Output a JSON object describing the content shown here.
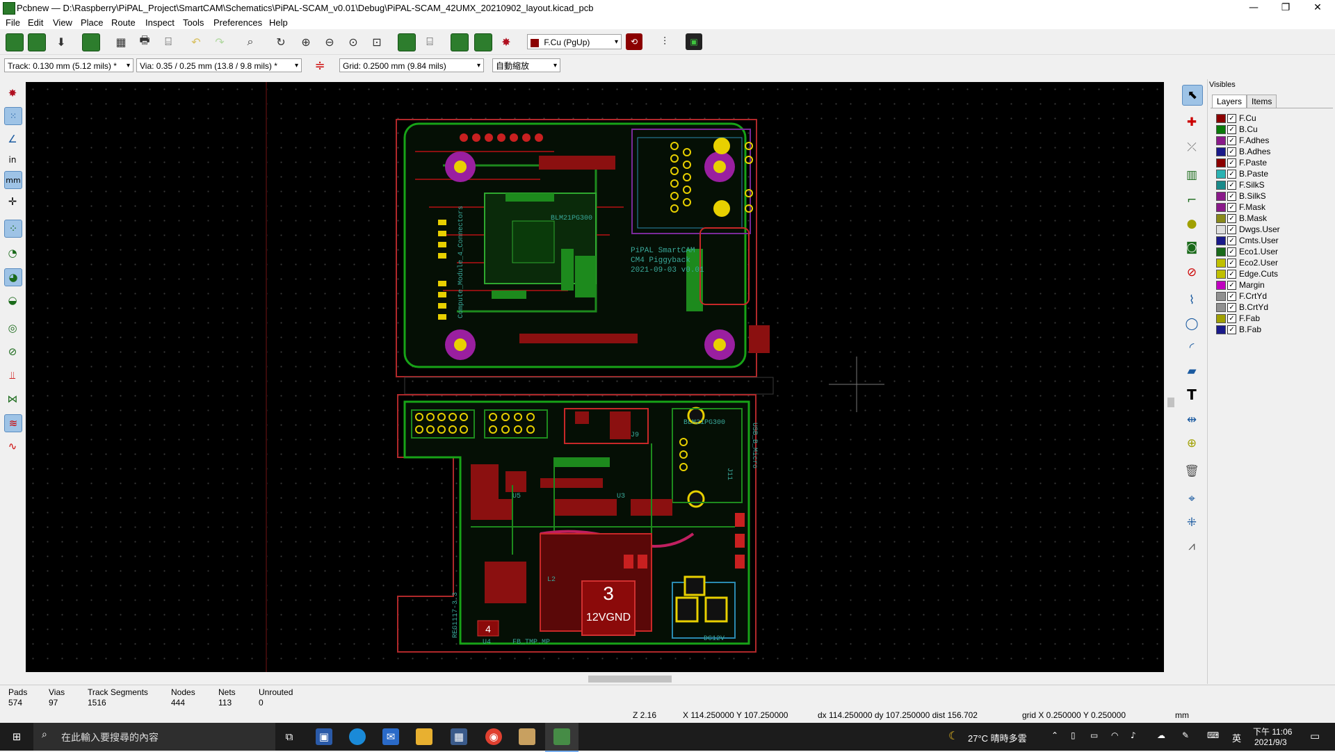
{
  "window": {
    "title": "Pcbnew — D:\\Raspberry\\PiPAL_Project\\SmartCAM\\Schematics\\PiPAL-SCAM_v0.01\\Debug\\PiPAL-SCAM_42UMX_20210902_layout.kicad_pcb",
    "minimize": "—",
    "restore": "❐",
    "close": "✕"
  },
  "menu": [
    "File",
    "Edit",
    "View",
    "Place",
    "Route",
    "Inspect",
    "Tools",
    "Preferences",
    "Help"
  ],
  "toolbar": {
    "layer_select": "F.Cu (PgUp)",
    "track": "Track: 0.130 mm (5.12 mils) *",
    "via": "Via: 0.35 / 0.25 mm (13.8 / 9.8 mils) *",
    "grid": "Grid: 0.2500 mm (9.84 mils)",
    "zoom": "自動縮放"
  },
  "pcb": {
    "silk": {
      "board_name": "PiPAL SmartCAM",
      "board_sub": "CM4 Piggyback",
      "board_date": "2021-09-03 v0.01",
      "compute_label": "Compute_Module_4_Connectors",
      "blm_top": "BLM21PG300",
      "blm_bottom": "BLM21PG300",
      "usb_label": "USB_B_Micro",
      "reg_label": "REG1117-3.3",
      "dc_label": "DC12V",
      "j9": "J9",
      "j11": "J11",
      "u4": "U4",
      "u5": "U5",
      "u3": "U3",
      "l2": "L2",
      "fb_label": "FB_TMP.MP",
      "pad3": "3",
      "net_12v": "12VGND",
      "pad4": "4"
    }
  },
  "layers_panel": {
    "header": "Visibles",
    "tabs": [
      "Layers",
      "Items"
    ],
    "layers": [
      {
        "name": "F.Cu",
        "color": "#8b0000"
      },
      {
        "name": "B.Cu",
        "color": "#0a7a0a"
      },
      {
        "name": "F.Adhes",
        "color": "#8a1a8a"
      },
      {
        "name": "B.Adhes",
        "color": "#1a1a8a"
      },
      {
        "name": "F.Paste",
        "color": "#8b0000"
      },
      {
        "name": "B.Paste",
        "color": "#2ab2b2"
      },
      {
        "name": "F.SilkS",
        "color": "#1a8a8a"
      },
      {
        "name": "B.SilkS",
        "color": "#8a1a8a"
      },
      {
        "name": "F.Mask",
        "color": "#8a1a8a"
      },
      {
        "name": "B.Mask",
        "color": "#8a8a1a"
      },
      {
        "name": "Dwgs.User",
        "color": "#e0e0e0"
      },
      {
        "name": "Cmts.User",
        "color": "#1a1a8a"
      },
      {
        "name": "Eco1.User",
        "color": "#1a6a1a"
      },
      {
        "name": "Eco2.User",
        "color": "#c0c000"
      },
      {
        "name": "Edge.Cuts",
        "color": "#c0c000"
      },
      {
        "name": "Margin",
        "color": "#c000c0"
      },
      {
        "name": "F.CrtYd",
        "color": "#909090"
      },
      {
        "name": "B.CrtYd",
        "color": "#909090"
      },
      {
        "name": "F.Fab",
        "color": "#a0a000"
      },
      {
        "name": "B.Fab",
        "color": "#1a1a8a"
      }
    ]
  },
  "stats": [
    {
      "label": "Pads",
      "value": "574"
    },
    {
      "label": "Vias",
      "value": "97"
    },
    {
      "label": "Track Segments",
      "value": "1516"
    },
    {
      "label": "Nodes",
      "value": "444"
    },
    {
      "label": "Nets",
      "value": "113"
    },
    {
      "label": "Unrouted",
      "value": "0"
    }
  ],
  "statusbar": {
    "zoom": "Z 2.16",
    "xy": "X 114.250000  Y 107.250000",
    "delta": "dx 114.250000  dy 107.250000  dist 156.702",
    "grid": "grid X 0.250000  Y 0.250000",
    "units": "mm"
  },
  "taskbar": {
    "search_placeholder": "在此輸入要搜尋的內容",
    "weather": "27°C  晴時多雲",
    "ime": "英",
    "time": "下午 11:06",
    "date": "2021/9/3"
  }
}
